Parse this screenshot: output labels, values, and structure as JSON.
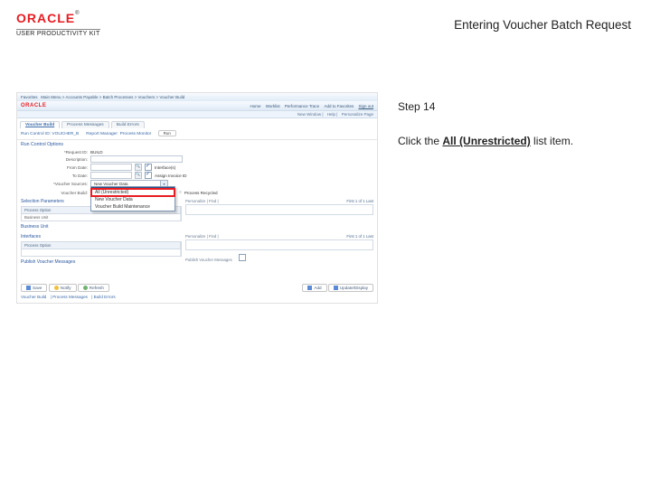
{
  "header": {
    "brand": "ORACLE",
    "tm": "®",
    "upk": "USER PRODUCTIVITY KIT",
    "title": "Entering Voucher Batch Request"
  },
  "instruction": {
    "step": "Step 14",
    "pre": "Click the ",
    "bold": "All (Unrestricted)",
    "post": " list item."
  },
  "app": {
    "brand": "ORACLE",
    "nav": [
      "Favorites",
      "Main Menu",
      "Accounts Payable",
      "Batch Processes",
      "Vouchers",
      "Voucher Build"
    ],
    "top_right": [
      "Home",
      "Worklist",
      "Performance Trace",
      "Add to Favorites",
      "Sign out"
    ],
    "sub_links": [
      "New Window",
      "Help",
      "Personalize Page"
    ],
    "tabs": [
      "Voucher Build",
      "Process Messages",
      "Build Errors"
    ],
    "tab_active": 0,
    "crumb_label": "Run Control ID:",
    "crumb_value": "VOUCHER_B",
    "crumb_extra": [
      "Report Manager",
      "Process Monitor"
    ],
    "crumb_button": "Run",
    "section": "Run Control Options",
    "rows": {
      "request_id": {
        "label": "*Request ID:",
        "value": "BUILD"
      },
      "description": {
        "label": "Description:",
        "value": ""
      },
      "from_date": {
        "label": "From Date:",
        "value": "",
        "look": true,
        "chk1": "Interface(s)"
      },
      "to_date": {
        "label": "To Date:",
        "value": "",
        "look": true,
        "chk2": "Assign Invoice ID"
      },
      "voucher_sources": {
        "label": "*Voucher Sources:",
        "value": "New Voucher Data"
      },
      "voucher_build": {
        "label": "Voucher Build:",
        "value": "",
        "radio": "Process Recycled"
      }
    },
    "dropdown": {
      "options": [
        "",
        "All (Unrestricted)",
        "New Voucher Data",
        "Voucher Build Maintenance"
      ],
      "highlighted": 0,
      "boxed": 1
    },
    "panels": {
      "left1": {
        "title": "Selection Parameters",
        "bar": "",
        "page": "1 of 1",
        "hdr": [
          "Process Option"
        ],
        "cell": "Business Unit"
      },
      "left2": {
        "title": "Business Unit"
      },
      "left3": {
        "title": "Interfaces",
        "hdr": [
          "Process Option"
        ],
        "cell": ""
      },
      "left4": {
        "title": "Publish Voucher Messages"
      },
      "right1": {
        "title": "",
        "bar": "Personalize | Find |",
        "page": "First  1 of 1  Last"
      },
      "right2": {
        "title": "",
        "bar": "Personalize | Find |",
        "page": "First  1 of 1  Last"
      },
      "right3": {
        "title": "",
        "bar": "Publish Voucher Messages"
      }
    },
    "buttons": {
      "save": "Save",
      "notify": "Notify",
      "refresh": "Refresh",
      "add": "Add",
      "update": "Update/Display"
    },
    "footer_links": [
      "Voucher Build",
      "Process Messages",
      "Build Errors"
    ]
  }
}
